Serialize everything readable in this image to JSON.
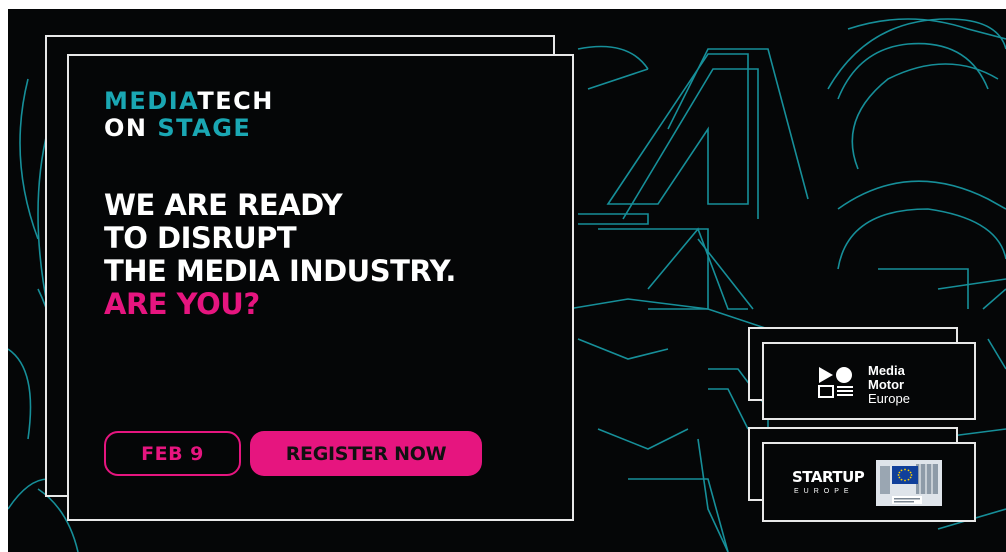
{
  "brand": {
    "line1_a": "MEDIA",
    "line1_b": "TECH",
    "line2_a": "ON ",
    "line2_b": "STAGE"
  },
  "headline": {
    "line1": "WE ARE READY",
    "line2": "TO DISRUPT",
    "line3": "THE MEDIA INDUSTRY.",
    "line4": "ARE YOU?"
  },
  "buttons": {
    "date": "FEB 9",
    "register": "REGISTER NOW"
  },
  "partners": {
    "media_motor": {
      "line1": "Media",
      "line2": "Motor",
      "line3": "Europe"
    },
    "startup_europe": {
      "title": "STARTUP",
      "subtitle": "EUROPE"
    }
  },
  "colors": {
    "background": "#050607",
    "accent_teal": "#1aa7b3",
    "accent_pink": "#e6157f",
    "frame": "#e8e8e8"
  },
  "icons": [
    "media-motor-logo-icon",
    "eu-flag-icon",
    "european-commission-building-icon"
  ]
}
